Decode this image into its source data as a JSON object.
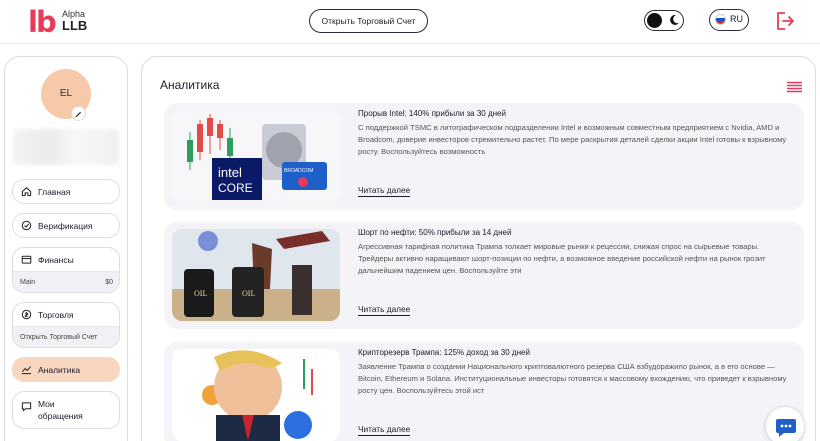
{
  "header": {
    "logo_mark": "lb",
    "logo_alpha": "Alpha",
    "logo_llb": "LLB",
    "open_account_label": "Открыть Торговый Счет",
    "theme_toggle_icon": "moon-icon",
    "language": "RU",
    "flag_colors": [
      "#ffffff",
      "#1c4fbf",
      "#d52b1e"
    ],
    "logout_icon": "logout-icon"
  },
  "sidebar": {
    "avatar_initials": "EL",
    "edit_icon": "pencil-icon",
    "items": [
      {
        "label": "Главная",
        "icon": "home-icon"
      },
      {
        "label": "Верификация",
        "icon": "verify-icon"
      },
      {
        "label": "Финансы",
        "icon": "wallet-icon",
        "sub_label": "Main",
        "sub_value": "$0"
      },
      {
        "label": "Торговля",
        "icon": "trade-icon",
        "sub_label": "Открыть Торговый Счет"
      },
      {
        "label": "Аналитика",
        "icon": "chart-icon",
        "active": true
      },
      {
        "label": "Мои обращения",
        "icon": "support-icon"
      }
    ]
  },
  "main": {
    "title": "Аналитика",
    "menu_icon": "hamburger-icon",
    "accent_color": "#e63b5a",
    "articles": [
      {
        "title": "Прорыв Intel: 140% прибыли за 30 дней",
        "text": "С поддержкой TSMC в литографическом подразделении Intel и возможным совместным предприятием с Nvidia, AMD и Broadcom, доверие инвесторов стремительно растет. По мере раскрытия деталей сделки акции Intel готовы к взрывному росту. Воспользуйтесь возможность",
        "read_more": "Читать далее",
        "image_text_1": "intel",
        "image_text_2": "CORE",
        "image_text_3": "BROADCOM"
      },
      {
        "title": "Шорт по нефти: 50% прибыли за 14 дней",
        "text": "Агрессивная тарифная политика Трампа толкает мировые рынки к рецессии, снижая спрос на сырьевые товары. Трейдеры активно наращивают шорт-позиции по нефти, а возможное введение российской нефти на рынок грозит дальнейшим падением цен. Воспользуйте эти",
        "read_more": "Читать далее",
        "image_text_1": "OIL",
        "image_text_2": "OIL"
      },
      {
        "title": "Крипторезерв Трампа: 125% доход за 30 дней",
        "text": "Заявление Трампа о создании Национального криптовалютного резерва США взбудоражило рынок, а в его основе — Bitcoin, Ethereum и Solana. Институциональные инвесторы готовятся к массовому вхождению, что приведет к взрывному росту цен. Воспользуйтесь этой ист",
        "read_more": "Читать далее"
      }
    ]
  },
  "chat_icon": "chat-icon"
}
